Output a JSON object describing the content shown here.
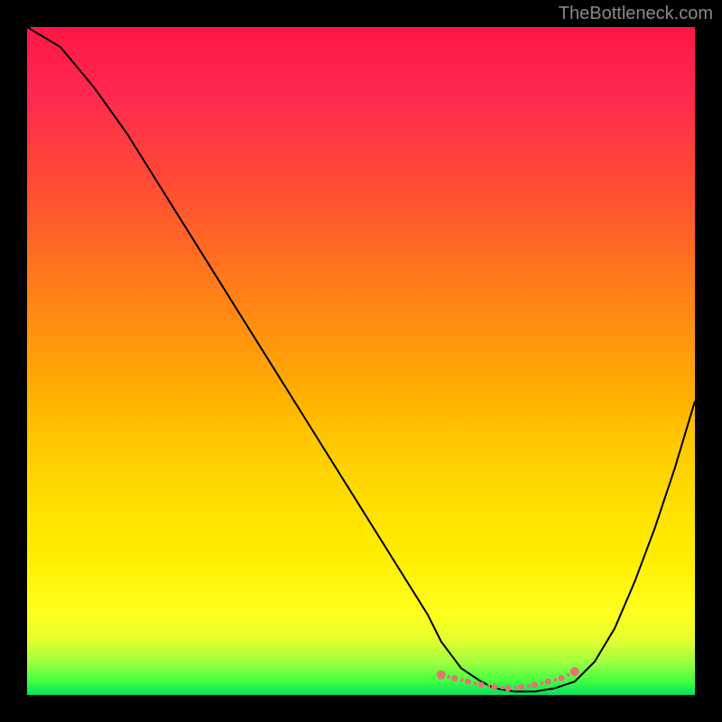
{
  "watermark": "TheBottleneck.com",
  "chart_data": {
    "type": "line",
    "title": "",
    "xlabel": "",
    "ylabel": "",
    "xlim": [
      0,
      100
    ],
    "ylim": [
      0,
      100
    ],
    "series": [
      {
        "name": "bottleneck-curve",
        "x": [
          0,
          5,
          10,
          15,
          20,
          25,
          30,
          35,
          40,
          45,
          50,
          55,
          60,
          62,
          65,
          68,
          70,
          73,
          76,
          79,
          82,
          85,
          88,
          91,
          94,
          97,
          100
        ],
        "y": [
          100,
          97,
          91,
          84,
          76,
          68,
          60,
          52,
          44,
          36,
          28,
          20,
          12,
          8,
          4,
          2,
          1,
          0.5,
          0.5,
          1,
          2,
          5,
          10,
          17,
          25,
          34,
          44
        ],
        "color": "#000000"
      },
      {
        "name": "optimal-range-marker",
        "x": [
          62,
          64,
          66,
          68,
          70,
          72,
          74,
          76,
          78,
          80,
          82
        ],
        "y": [
          3,
          2.5,
          2,
          1.5,
          1.2,
          1,
          1.2,
          1.5,
          2,
          2.5,
          3.5
        ],
        "color": "#e57373",
        "style": "dotted-thick"
      }
    ],
    "gradient_background": {
      "top": "#ff1744",
      "middle": "#ffd000",
      "bottom": "#00e060"
    }
  }
}
